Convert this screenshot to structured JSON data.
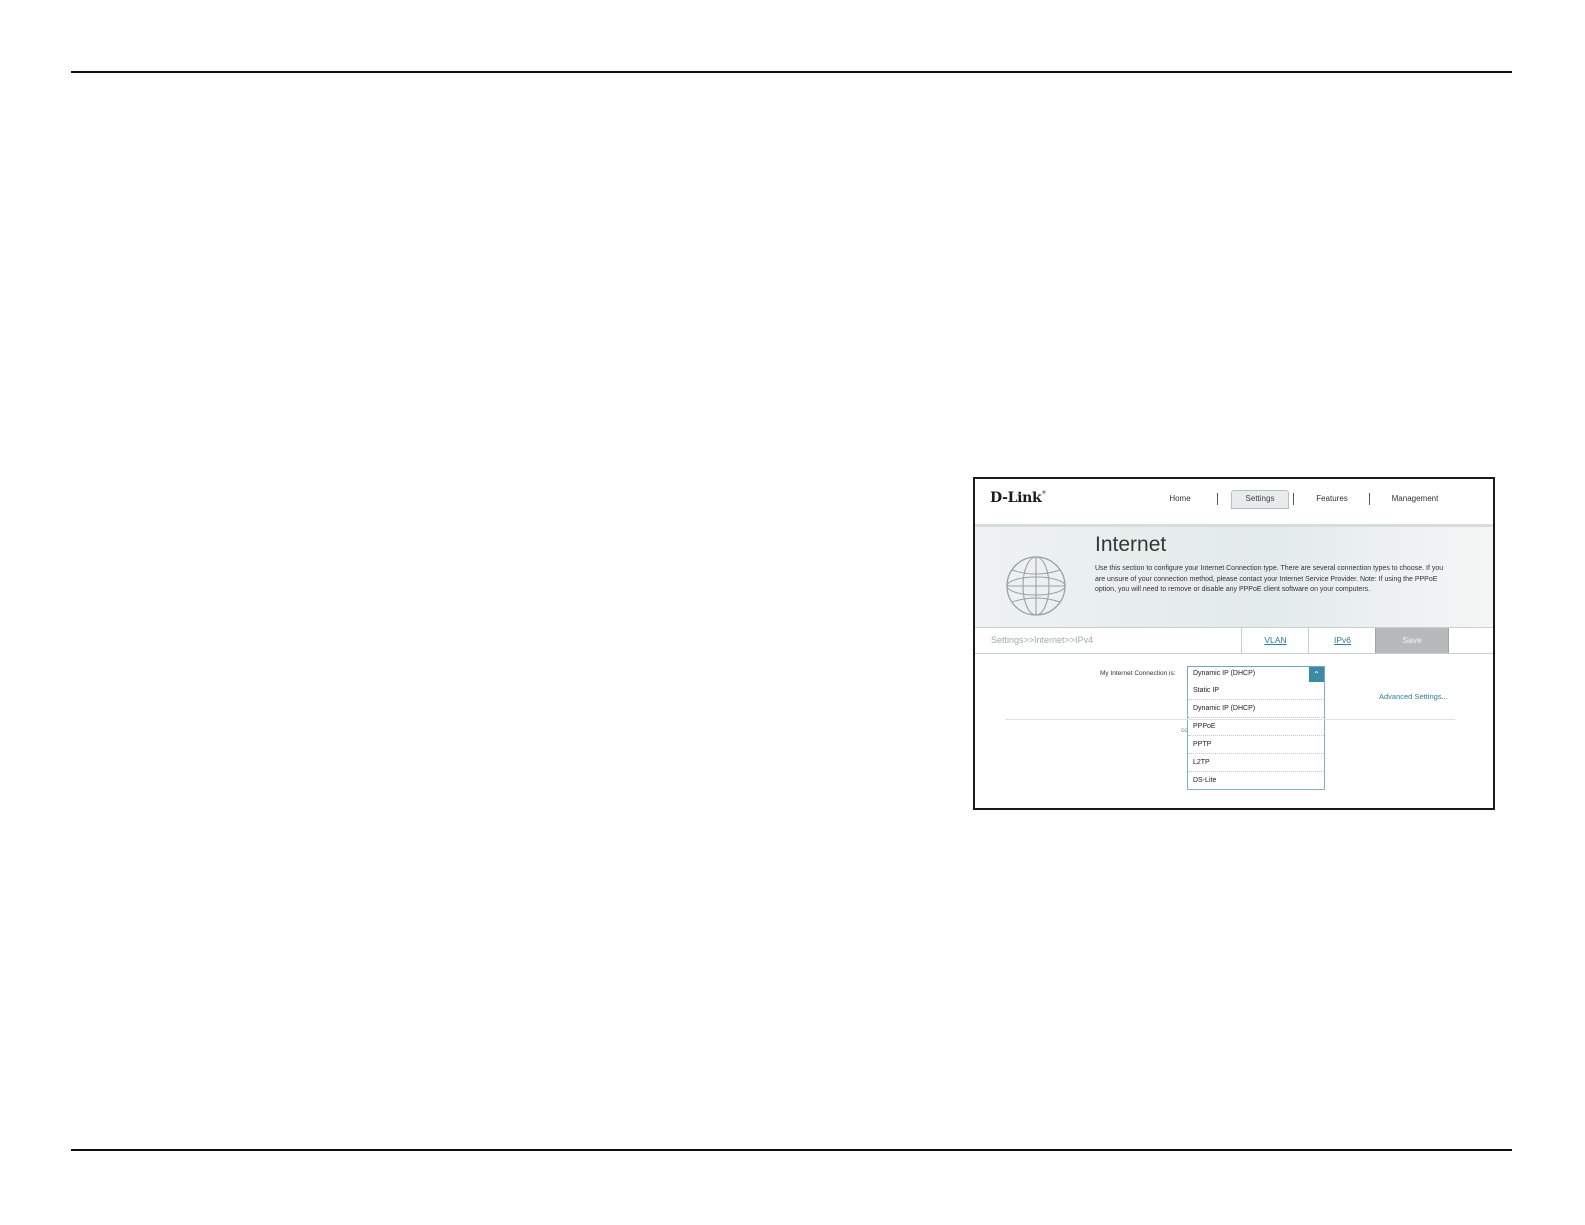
{
  "router_ui": {
    "logo": "D-Link",
    "nav": {
      "home": "Home",
      "settings": "Settings",
      "features": "Features",
      "management": "Management"
    },
    "banner": {
      "title": "Internet",
      "description": "Use this section to configure your Internet Connection type. There are several connection types to choose. If you are unsure of your connection method, please contact your Internet Service Provider. Note: If using the PPPoE option, you will need to remove or disable any PPPoE client software on your computers."
    },
    "breadcrumb": "Settings>>Internet>>IPv4",
    "tabs": {
      "vlan": "VLAN",
      "ipv6": "IPv6",
      "save": "Save"
    },
    "connection": {
      "label": "My Internet Connection is:",
      "selected": "Dynamic IP (DHCP)",
      "options": [
        "Static IP",
        "Dynamic IP (DHCP)",
        "PPPoE",
        "PPTP",
        "L2TP",
        "DS-Lite"
      ]
    },
    "advanced_link": "Advanced Settings...",
    "partial_text": "co"
  },
  "colors": {
    "accent": "#3e8aa5",
    "link": "#2c7da0",
    "save_button": "#b7b9ba"
  }
}
